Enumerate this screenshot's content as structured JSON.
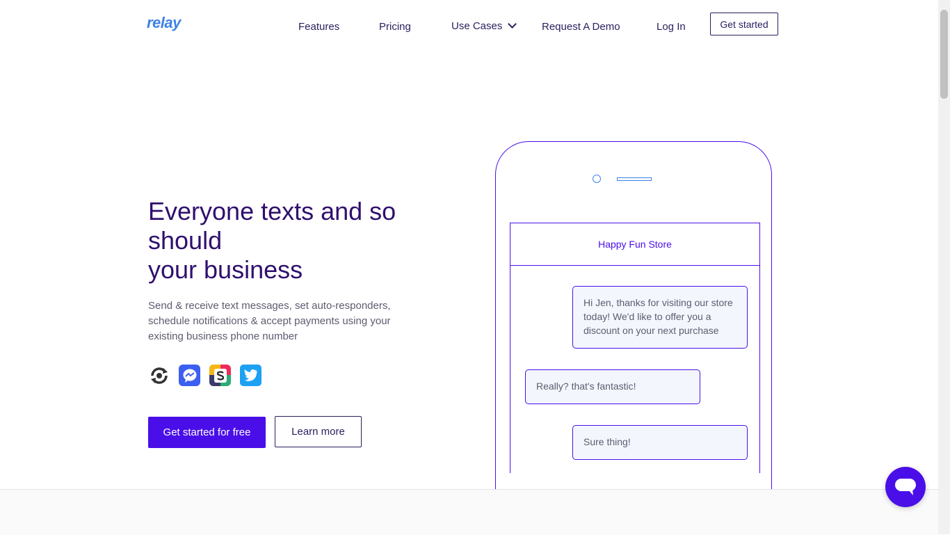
{
  "header": {
    "logo": "relay",
    "nav": {
      "features": "Features",
      "pricing": "Pricing",
      "use_cases": "Use Cases",
      "request_demo": "Request A Demo",
      "login": "Log In"
    },
    "get_started": "Get started"
  },
  "hero": {
    "title_line1": "Everyone texts and so should",
    "title_line2": "your business",
    "subtitle": "Send & receive text messages, set auto-responders, schedule notifications & accept payments using your existing business phone number",
    "integrations": [
      "circle-arrows-icon",
      "messenger-icon",
      "slack-icon",
      "twitter-icon"
    ],
    "cta_primary": "Get started for free",
    "cta_secondary": "Learn more"
  },
  "phone": {
    "contact_name": "Happy Fun Store",
    "messages": [
      {
        "side": "right",
        "text": "Hi Jen, thanks for visiting our store today! We'd like to offer you a discount on your next purchase"
      },
      {
        "side": "left",
        "text": "Really? that's fantastic!"
      },
      {
        "side": "right",
        "text": "Sure thing!"
      },
      {
        "side": "right",
        "text": ""
      }
    ]
  },
  "colors": {
    "brand_purple": "#4a0fe8",
    "heading": "#2f0f6e",
    "logo_blue": "#3d82e6",
    "nav_text": "#2b1d5e"
  }
}
